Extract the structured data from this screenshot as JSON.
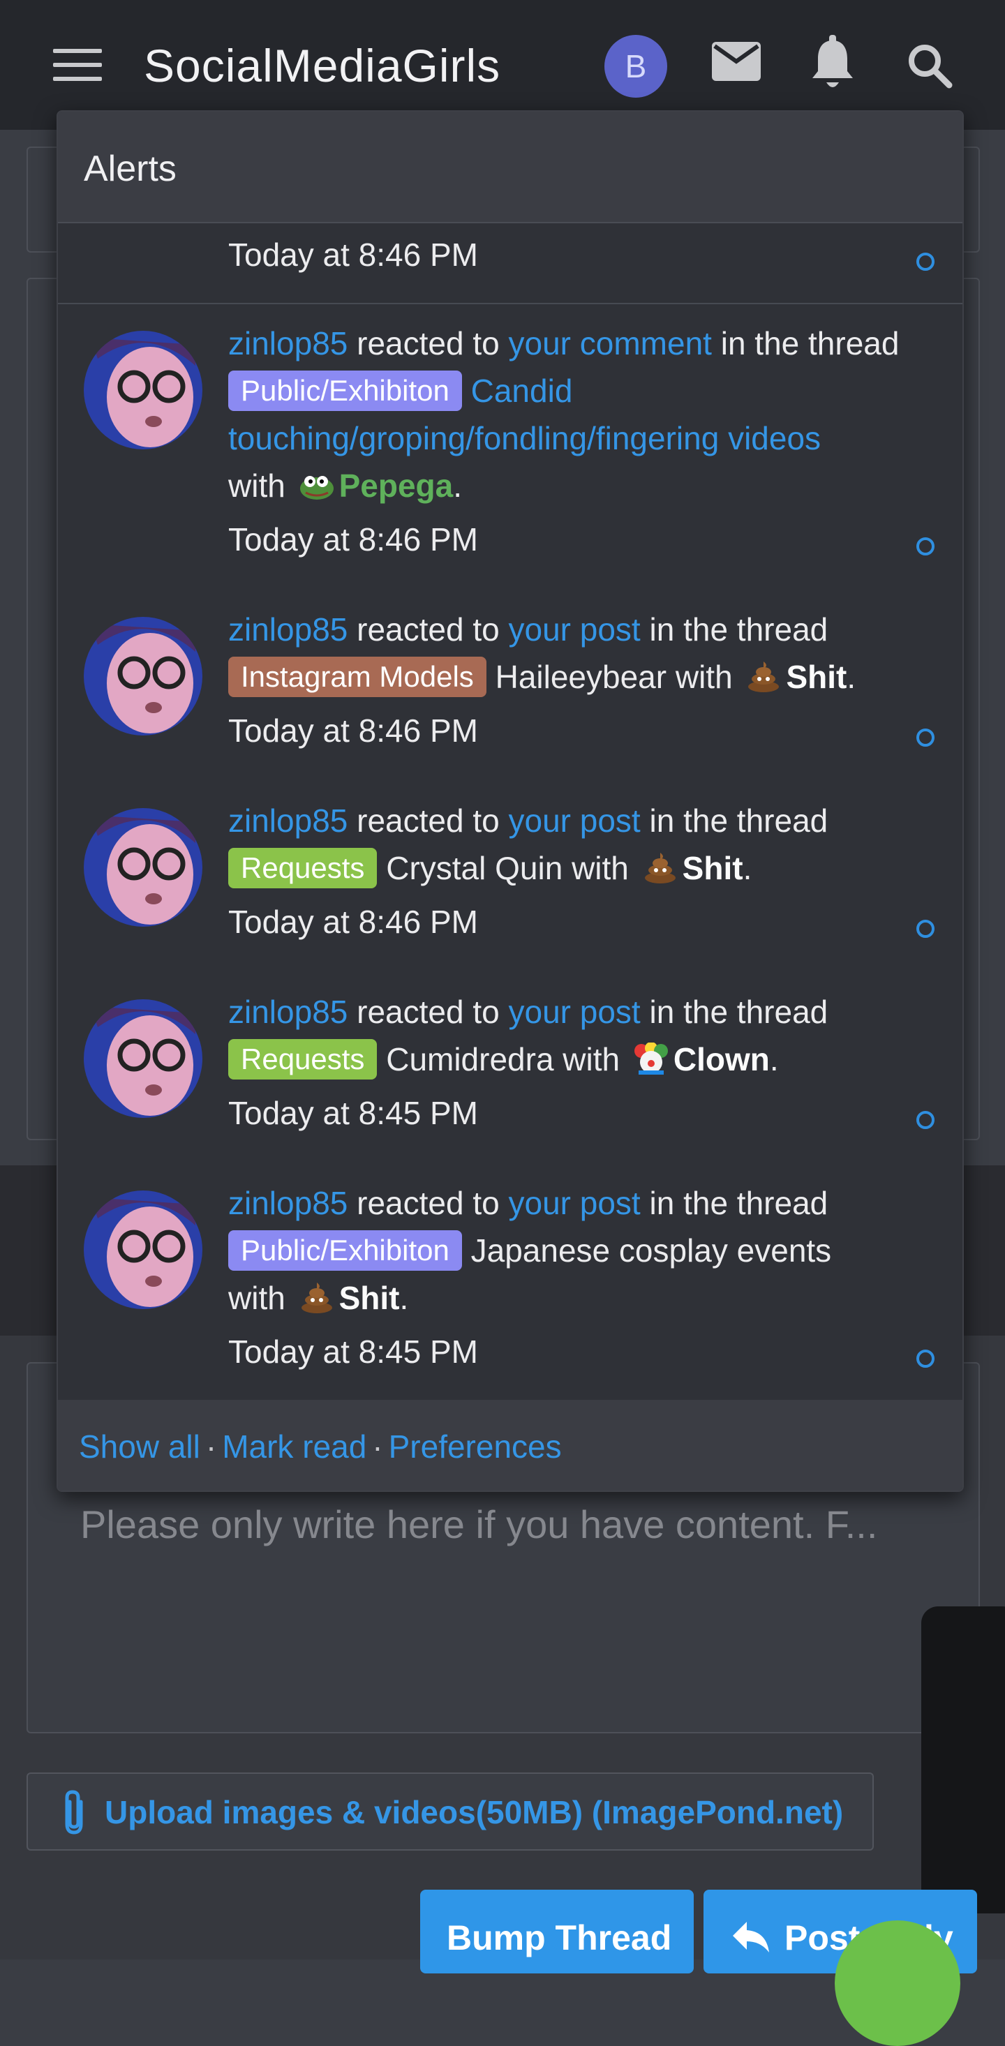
{
  "header": {
    "site_title": "SocialMediaGirls",
    "avatar_letter": "B"
  },
  "alerts_popup": {
    "title": "Alerts",
    "partial_time": "Today at 8:46 PM",
    "items": [
      {
        "user": "zinlop85",
        "verb": " reacted to ",
        "target": "your comment",
        "mid": " in the thread ",
        "prefix": "Public/Exhibiton",
        "thread": "Candid touching/groping/fondling/fingering videos",
        "with": " with ",
        "reaction": "Pepega",
        "time": "Today at 8:46 PM"
      },
      {
        "user": "zinlop85",
        "verb": " reacted to ",
        "target": "your post",
        "mid": " in the thread ",
        "prefix": "Instagram Models",
        "thread": "Haileeybear",
        "with": " with ",
        "reaction": "Shit",
        "time": "Today at 8:46 PM"
      },
      {
        "user": "zinlop85",
        "verb": " reacted to ",
        "target": "your post",
        "mid": " in the thread ",
        "prefix": "Requests",
        "thread": "Crystal Quin",
        "with": " with ",
        "reaction": "Shit",
        "time": "Today at 8:46 PM"
      },
      {
        "user": "zinlop85",
        "verb": " reacted to ",
        "target": "your post",
        "mid": " in the thread ",
        "prefix": "Requests",
        "thread": "Cumidredra",
        "with": " with ",
        "reaction": "Clown",
        "time": "Today at 8:45 PM"
      },
      {
        "user": "zinlop85",
        "verb": " reacted to ",
        "target": "your post",
        "mid": " in the thread ",
        "prefix": "Public/Exhibiton",
        "thread": "Japanese cosplay events",
        "with": " with ",
        "reaction": "Shit",
        "time": "Today at 8:45 PM"
      }
    ],
    "footer": {
      "show_all": "Show all",
      "separator": "·",
      "mark_read": "Mark read",
      "preferences": "Preferences"
    }
  },
  "editor": {
    "placeholder": "Please only write here if you have content. F..."
  },
  "upload": {
    "label": "Upload images & videos(50MB) (ImagePond.net)"
  },
  "actions": {
    "bump": "Bump Thread",
    "post_reply": "Post reply"
  },
  "colors": {
    "accent": "#3596e6",
    "header_bg": "#25272c",
    "popup_bg": "#2f3137",
    "tag_purple": "#8b8af2",
    "tag_brown": "#a86a54",
    "tag_green": "#8bc34a",
    "reaction_green": "#5fb15b"
  }
}
